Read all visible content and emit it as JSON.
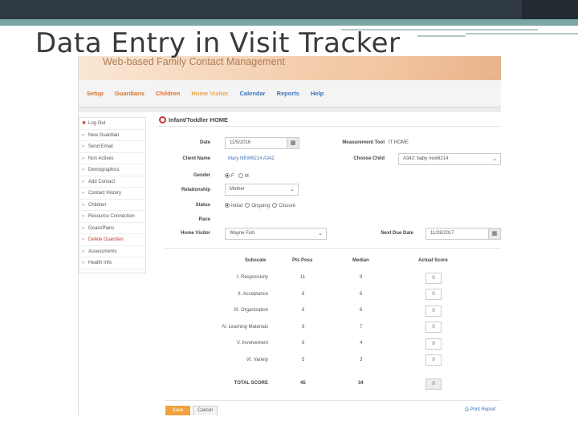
{
  "slide": {
    "title": "Data Entry in Visit Tracker"
  },
  "app": {
    "header_title": "Web-based Family Contact Management",
    "nav": [
      {
        "label": "Setup"
      },
      {
        "label": "Guardians"
      },
      {
        "label": "Children"
      },
      {
        "label": "Home Visitor"
      },
      {
        "label": "Calendar"
      },
      {
        "label": "Reports"
      },
      {
        "label": "Help"
      }
    ],
    "sidebar": [
      {
        "label": "Log Out"
      },
      {
        "label": "New Guardian"
      },
      {
        "label": "Send Email"
      },
      {
        "label": "Non Actives"
      },
      {
        "label": "Demographics"
      },
      {
        "label": "Add Contact"
      },
      {
        "label": "Contact History"
      },
      {
        "label": "Children"
      },
      {
        "label": "Resource Connection"
      },
      {
        "label": "Goals/Plans"
      },
      {
        "label": "Delete Guardian"
      },
      {
        "label": "Assessments"
      },
      {
        "label": "Health Info"
      }
    ],
    "form": {
      "title": "Infant/Toddler HOME",
      "date_label": "Date",
      "date_value": "11/5/2016",
      "client_name_label": "Client Name",
      "client_name_value": "Mary NEW6214 A342",
      "gender_label": "Gender",
      "gender_options": [
        "F",
        "M"
      ],
      "relationship_label": "Relationship",
      "relationship_value": "Mother",
      "status_label": "Status",
      "status_options": [
        "Initial",
        "Ongoing",
        "Closure"
      ],
      "race_label": "Race",
      "home_visitor_label": "Home Visitor",
      "home_visitor_value": "Wayne Fish",
      "measurement_tool_label": "Measurement Tool",
      "measurement_tool_value": "IT HOME",
      "choose_child_label": "Choose Child",
      "choose_child_value": "A342: baby new6214",
      "next_due_label": "Next Due Date",
      "next_due_value": "11/28/2017",
      "calendar_icon": "calendar-icon",
      "dropdown_icon": "chevron-down-icon"
    },
    "table": {
      "headers": [
        "Subscale",
        "Pts Poss",
        "Median",
        "Actual Score"
      ],
      "rows": [
        {
          "subscale": "I. Responsivity",
          "pts": "11",
          "median": "9",
          "score": "0"
        },
        {
          "subscale": "II. Acceptance",
          "pts": "8",
          "median": "6",
          "score": "0"
        },
        {
          "subscale": "III. Organization",
          "pts": "6",
          "median": "6",
          "score": "0"
        },
        {
          "subscale": "IV. Learning Materials",
          "pts": "9",
          "median": "7",
          "score": "0"
        },
        {
          "subscale": "V. Involvement",
          "pts": "6",
          "median": "4",
          "score": "0"
        },
        {
          "subscale": "VI. Variety",
          "pts": "5",
          "median": "3",
          "score": "0"
        }
      ],
      "total": {
        "label": "TOTAL SCORE",
        "pts": "45",
        "median": "34",
        "score": "0"
      }
    },
    "footer": {
      "save_label": "Save",
      "cancel_label": "Cancel",
      "print_label": "Print Report"
    }
  }
}
